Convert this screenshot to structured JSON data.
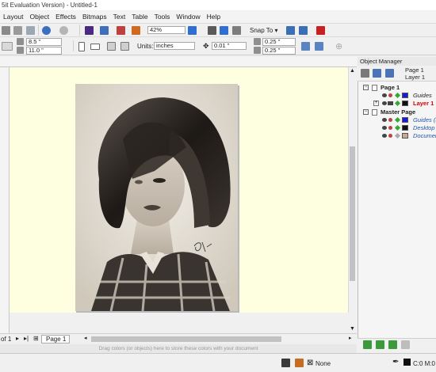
{
  "window": {
    "title": "5it Evaluation Version) - Untitled-1"
  },
  "menu": [
    "Layout",
    "Object",
    "Effects",
    "Bitmaps",
    "Text",
    "Table",
    "Tools",
    "Window",
    "Help"
  ],
  "toolbar": {
    "zoom": "42%",
    "snap_to": "Snap To"
  },
  "property_bar": {
    "width": "8.5 \"",
    "height": "11.0 \"",
    "units_label": "Units:",
    "units_value": "inches",
    "nudge": "0.01 \"",
    "dup_x": "0.25 \"",
    "dup_y": "0.25 \""
  },
  "page_nav": {
    "page_count": "of 1",
    "page_tab": "Page 1"
  },
  "palette_hint": "Drag colors (or objects) here to store these colors with your document",
  "status": {
    "fill": "None",
    "outline": "C:0 M:0"
  },
  "object_manager": {
    "title": "Object Manager",
    "header_page": "Page 1",
    "header_layer": "Layer 1",
    "rows": [
      {
        "label": "Page 1",
        "type": "page"
      },
      {
        "label": "Guides",
        "type": "layer",
        "color": "#1a1adb"
      },
      {
        "label": "Layer 1",
        "type": "layer",
        "color": "#111111"
      },
      {
        "label": "Master Page",
        "type": "page"
      },
      {
        "label": "Guides (al",
        "type": "layer",
        "color": "#1a1adb"
      },
      {
        "label": "Desktop",
        "type": "layer",
        "color": "#111111"
      },
      {
        "label": "Documen",
        "type": "layer",
        "color": "#c9a98f"
      }
    ]
  },
  "colors": {
    "canvas": "#fefee0",
    "accent_red": "#d40000",
    "link_blue": "#2255aa"
  }
}
